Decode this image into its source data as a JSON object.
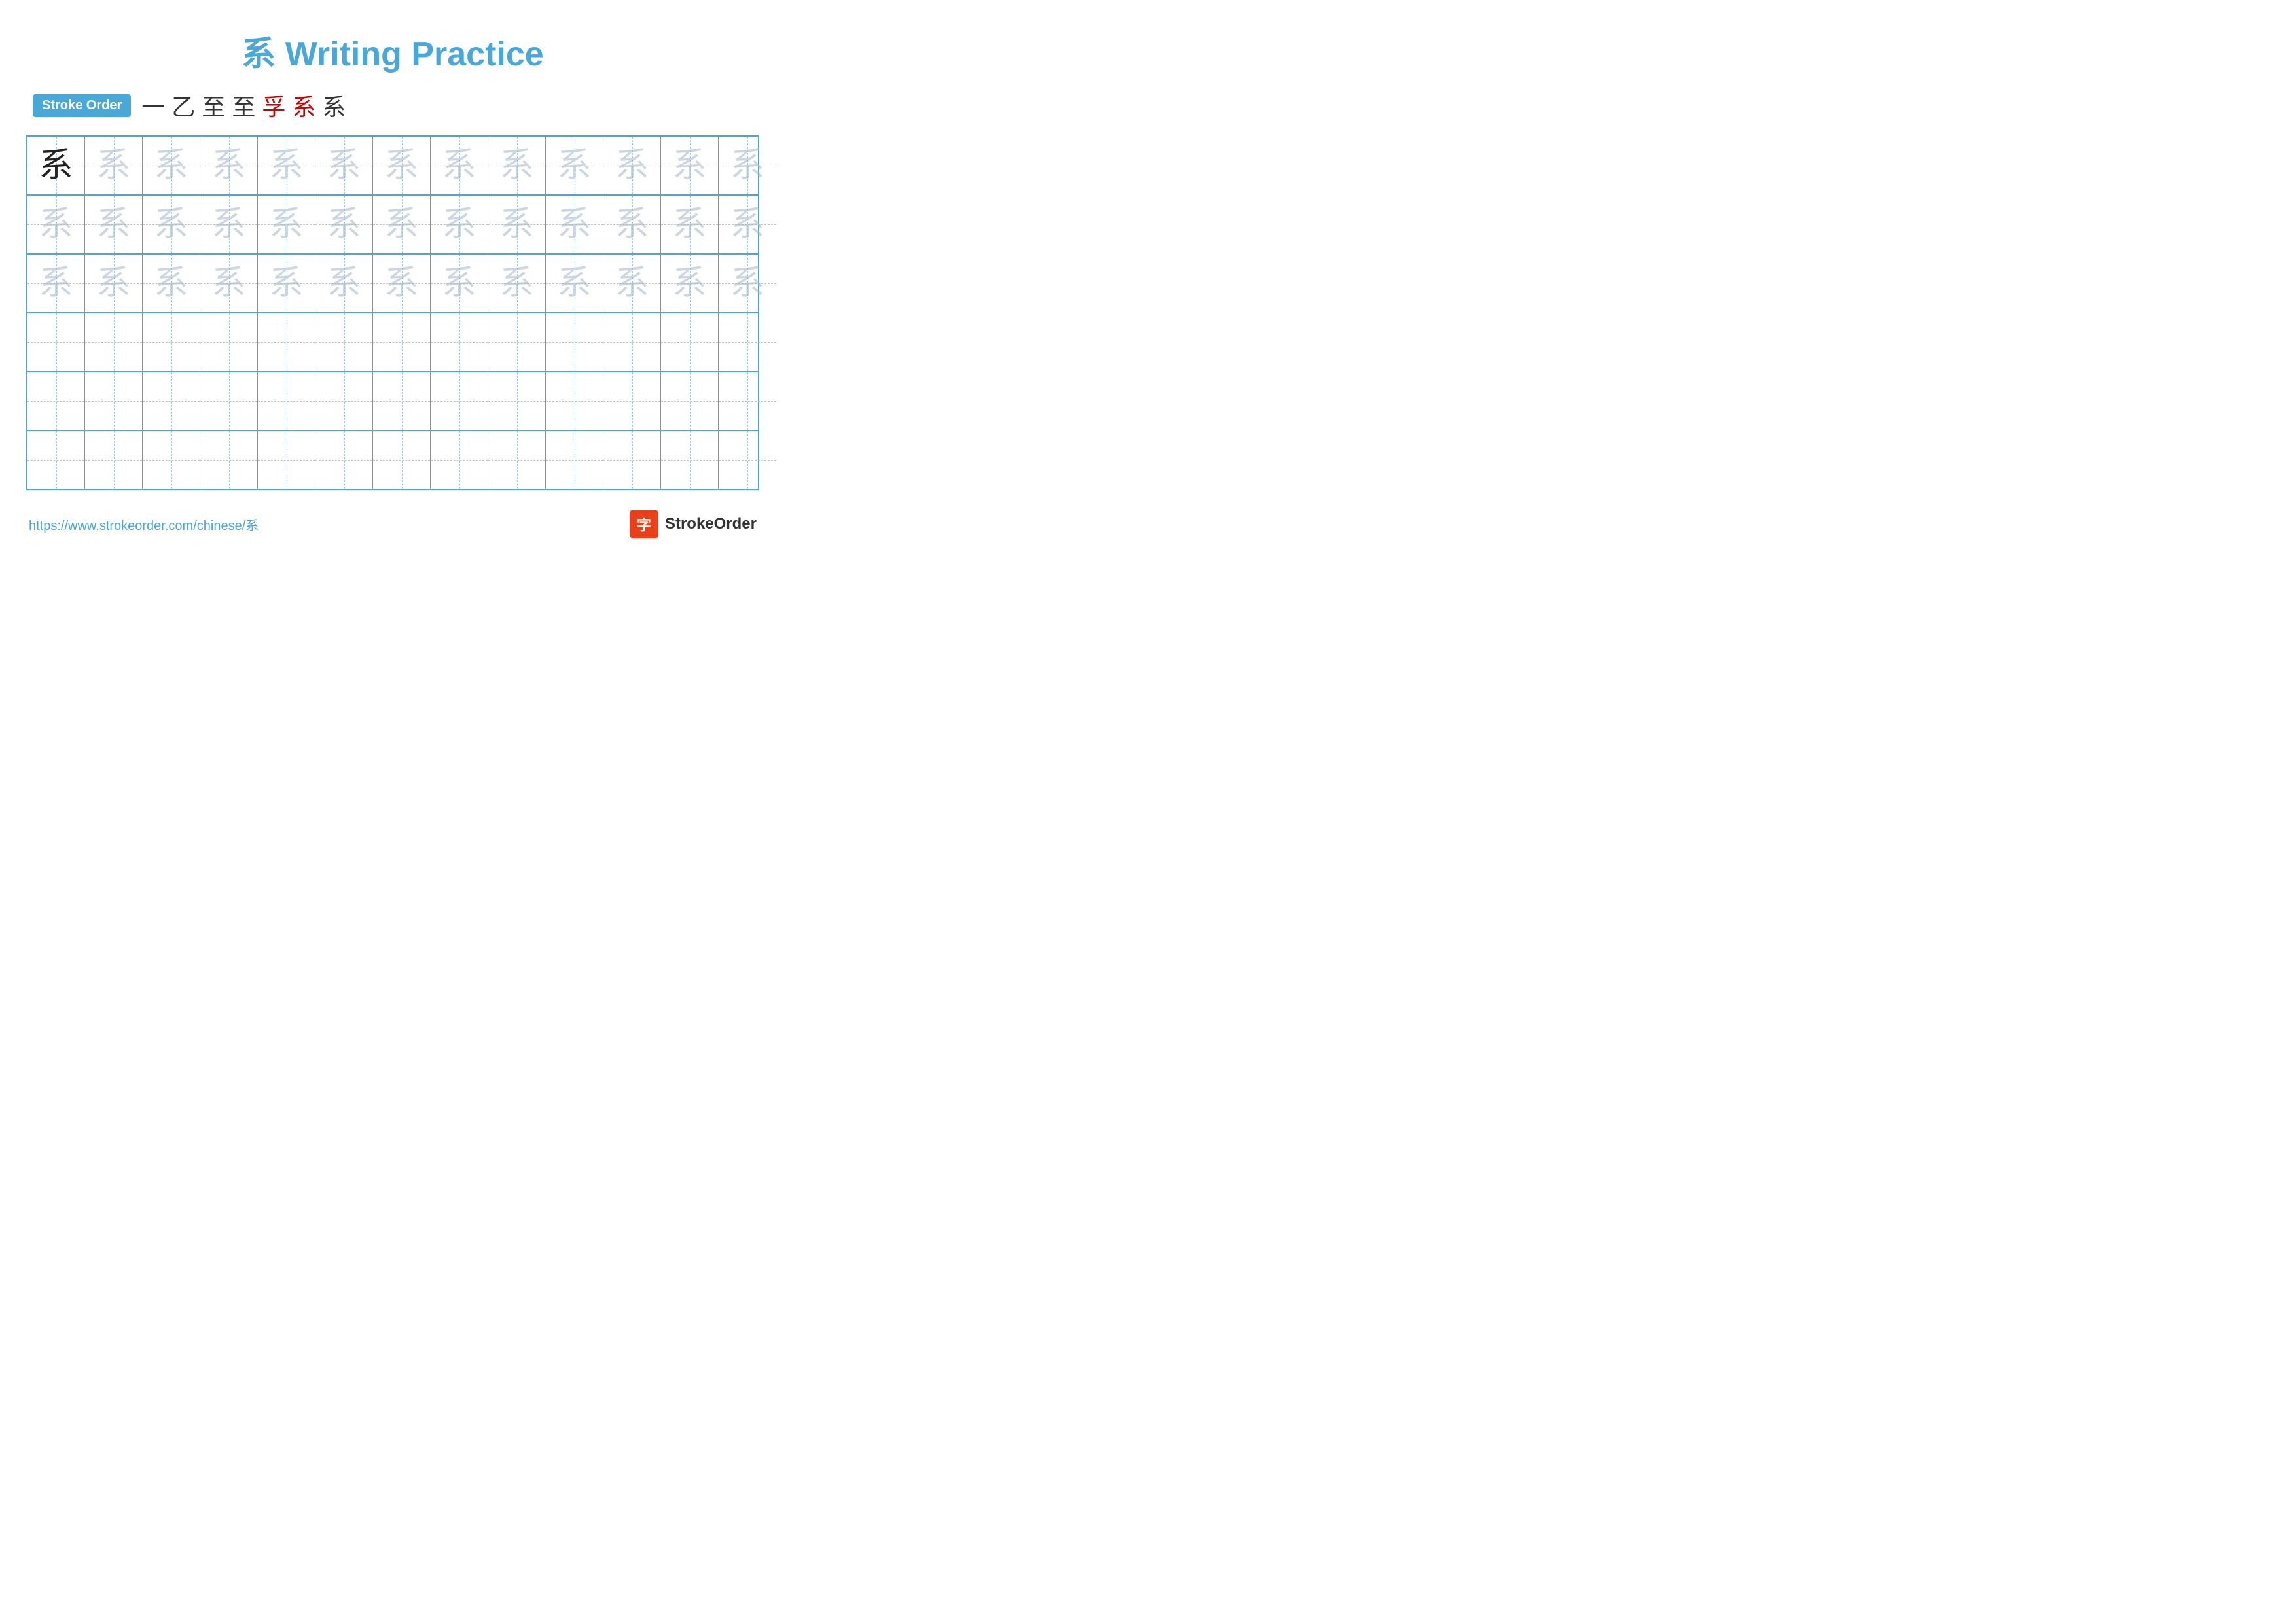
{
  "title": {
    "character": "系",
    "text": " Writing Practice"
  },
  "stroke_order": {
    "badge_label": "Stroke Order",
    "strokes": [
      "一",
      "乙",
      "至",
      "至",
      "孚",
      "系",
      "系"
    ]
  },
  "grid": {
    "cols": 13,
    "rows": 6,
    "practice_char": "系",
    "filled_rows": [
      {
        "type": "dark_first",
        "chars": [
          "dark",
          "light",
          "light",
          "light",
          "light",
          "light",
          "light",
          "light",
          "light",
          "light",
          "light",
          "light",
          "light"
        ]
      },
      {
        "type": "light",
        "chars": [
          "light",
          "light",
          "light",
          "light",
          "light",
          "light",
          "light",
          "light",
          "light",
          "light",
          "light",
          "light",
          "light"
        ]
      },
      {
        "type": "light",
        "chars": [
          "light",
          "light",
          "light",
          "light",
          "light",
          "light",
          "light",
          "light",
          "light",
          "light",
          "light",
          "light",
          "light"
        ]
      },
      {
        "type": "empty"
      },
      {
        "type": "empty"
      },
      {
        "type": "empty"
      }
    ]
  },
  "footer": {
    "url": "https://www.strokeorder.com/chinese/系",
    "brand_name": "StrokeOrder",
    "brand_char": "字"
  }
}
